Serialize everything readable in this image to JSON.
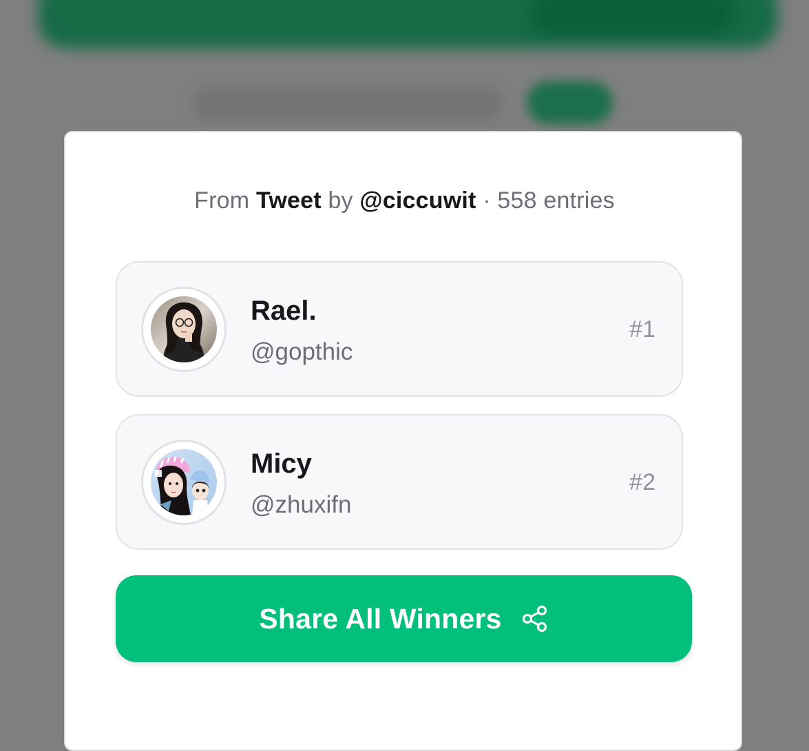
{
  "source": {
    "prefix": "From",
    "platform": "Tweet",
    "by": "by",
    "author": "@ciccuwit",
    "separator": "·",
    "entries": "558 entries"
  },
  "winners": [
    {
      "name": "Rael.",
      "handle": "@gopthic",
      "rank": "#1",
      "avatar_icon": "profile-photo"
    },
    {
      "name": "Micy",
      "handle": "@zhuxifn",
      "rank": "#2",
      "avatar_icon": "profile-photo"
    }
  ],
  "share_button": {
    "label": "Share All Winners",
    "icon": "share-icon"
  },
  "colors": {
    "accent": "#02bf7c",
    "overlay": "#7f7f7f",
    "card_bg": "#f8f8fa",
    "text_primary": "#17181c",
    "text_secondary": "#6b6e78"
  }
}
